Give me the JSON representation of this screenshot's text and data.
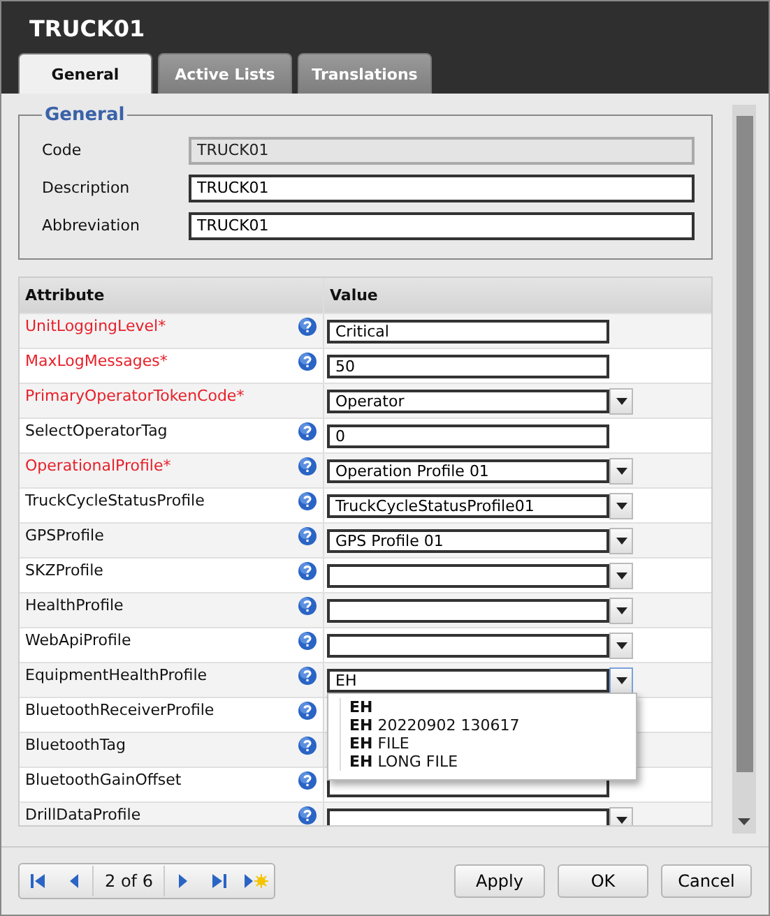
{
  "window": {
    "title": "TRUCK01"
  },
  "tabs": [
    {
      "label": "General",
      "selected": true
    },
    {
      "label": "Active Lists",
      "selected": false
    },
    {
      "label": "Translations",
      "selected": false
    }
  ],
  "general": {
    "legend": "General",
    "fields": [
      {
        "label": "Code",
        "value": "TRUCK01",
        "disabled": true
      },
      {
        "label": "Description",
        "value": "TRUCK01",
        "disabled": false
      },
      {
        "label": "Abbreviation",
        "value": "TRUCK01",
        "disabled": false
      }
    ]
  },
  "table": {
    "columns": [
      "Attribute",
      "Value"
    ],
    "rows": [
      {
        "label": "UnitLoggingLevel*",
        "required": true,
        "help": true,
        "kind": "text",
        "value": "Critical"
      },
      {
        "label": "MaxLogMessages*",
        "required": true,
        "help": true,
        "kind": "text",
        "value": "50"
      },
      {
        "label": "PrimaryOperatorTokenCode*",
        "required": true,
        "help": false,
        "kind": "select",
        "value": "Operator"
      },
      {
        "label": "SelectOperatorTag",
        "required": false,
        "help": true,
        "kind": "text",
        "value": "0"
      },
      {
        "label": "OperationalProfile*",
        "required": true,
        "help": true,
        "kind": "select",
        "value": "Operation Profile 01"
      },
      {
        "label": "TruckCycleStatusProfile",
        "required": false,
        "help": true,
        "kind": "select",
        "value": "TruckCycleStatusProfile01"
      },
      {
        "label": "GPSProfile",
        "required": false,
        "help": true,
        "kind": "select",
        "value": "GPS Profile 01"
      },
      {
        "label": "SKZProfile",
        "required": false,
        "help": true,
        "kind": "select"
      },
      {
        "label": "HealthProfile",
        "required": false,
        "help": true,
        "kind": "select"
      },
      {
        "label": "WebApiProfile",
        "required": false,
        "help": true,
        "kind": "select"
      },
      {
        "label": "EquipmentHealthProfile",
        "required": false,
        "help": true,
        "kind": "select",
        "value": "EH",
        "open": true,
        "options": [
          "**EH**",
          "**EH** 20220902 130617",
          "**EH** FILE",
          "**EH** LONG FILE"
        ]
      },
      {
        "label": "BluetoothReceiverProfile",
        "required": false,
        "help": true,
        "kind": "covered"
      },
      {
        "label": "BluetoothTag",
        "required": false,
        "help": true,
        "kind": "covered"
      },
      {
        "label": "BluetoothGainOffset",
        "required": false,
        "help": true,
        "kind": "text"
      },
      {
        "label": "DrillDataProfile",
        "required": false,
        "help": true,
        "kind": "select"
      }
    ]
  },
  "pager": {
    "label": "2 of 6"
  },
  "buttons": [
    "Apply",
    "OK",
    "Cancel"
  ]
}
